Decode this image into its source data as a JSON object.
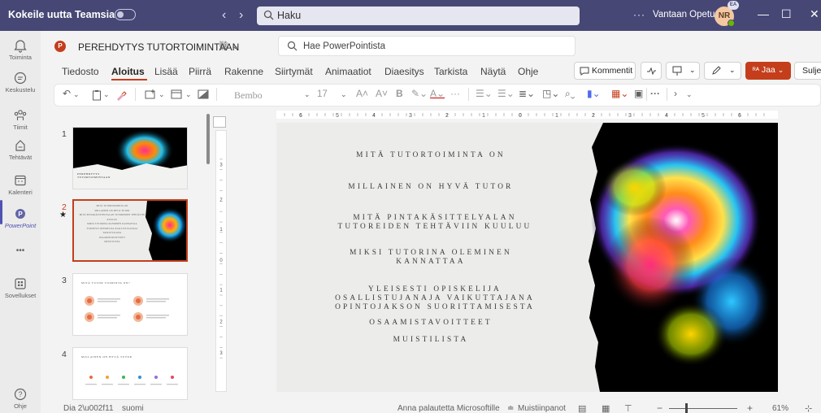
{
  "teams": {
    "title": "Kokeile uutta Teamsia",
    "search_placeholder": "Haku",
    "more": "···",
    "org": "Vantaan Opetus",
    "avatar_initials": "NR",
    "avatar_badge": "EA",
    "window_controls": [
      "—",
      "☐",
      "✕"
    ]
  },
  "rail": {
    "items": [
      {
        "label": "Toiminta",
        "icon": "bell-icon"
      },
      {
        "label": "Keskustelu",
        "icon": "chat-icon"
      },
      {
        "label": "Tiimit",
        "icon": "teams-icon"
      },
      {
        "label": "Tehtävät",
        "icon": "assignments-icon"
      },
      {
        "label": "Kalenteri",
        "icon": "calendar-icon"
      },
      {
        "label": "PowerPoint",
        "icon": "powerpoint-icon"
      },
      {
        "label": "•••",
        "icon": "more-icon"
      },
      {
        "label": "Sovellukset",
        "icon": "apps-icon"
      },
      {
        "label": "Ohje",
        "icon": "help-icon"
      }
    ],
    "active_index": 5
  },
  "ppt": {
    "app_badge": "P",
    "doc_title": "PEREHDYTYS TUTORTOIMINTAAN",
    "doc_title_suffix": "⛓ ⌄",
    "search_placeholder": "Hae PowerPointista",
    "tabs": [
      "Tiedosto",
      "Aloitus",
      "Lisää",
      "Piirrä",
      "Rakenne",
      "Siirtymät",
      "Animaatiot",
      "Diaesitys",
      "Tarkista",
      "Näytä",
      "Ohje"
    ],
    "active_tab": "Aloitus",
    "comments_label": "Kommentit",
    "share_label": "Jaa",
    "close_label": "Sulje",
    "font_name": "Bembo",
    "font_size": "17"
  },
  "thumbnails": [
    {
      "number": "1",
      "lines": [
        "PEREHDYTYS",
        "TUTORTOIMINTAAN"
      ]
    },
    {
      "number": "2",
      "star": "★",
      "lines": [
        "MITÄ TUTORTOIMINTA ON",
        "MILLAINEN ON HYVÄ TUTOR",
        "MITÄ PINTAKÄSITTELYALAN TUTOREIDEN TEHTÄVIIN KUULUU",
        "MIKSI TUTORINA OLEMINEN KANNATTAA",
        "YLEISESTI OPISKELIJA OSALLISTUJANAJA VAIKUTTAJANA",
        "OSAAMISTAVOITTEET",
        "MUISTILISTA"
      ]
    },
    {
      "number": "3",
      "lines": [
        "MITÄ TUTOR TOIMINTA ON?"
      ]
    },
    {
      "number": "4",
      "lines": [
        "MILLAINEN ON HYVÄ TUTOR"
      ]
    }
  ],
  "slide": {
    "items": [
      "MITÄ TUTORTOIMINTA ON",
      "MILLAINEN ON HYVÄ TUTOR",
      "MITÄ PINTAKÄSITTELYALAN\nTUTOREIDEN TEHTÄVIIN KUULUU",
      "MIKSI TUTORINA OLEMINEN\nKANNATTAA",
      "YLEISESTI OPISKELIJA\nOSALLISTUJANAJA VAIKUTTAJANA\nOPINTOJAKSON SUORITTAMISESTA",
      "OSAAMISTAVOITTEET",
      "MUISTILISTA"
    ]
  },
  "status": {
    "slide_info": "Dia 2\\u002f11",
    "language": "suomi",
    "feedback": "Anna palautetta Microsoftille",
    "notes": "Muistiinpanot",
    "zoom": "61%",
    "zoom_fraction": 0.25
  },
  "colors": {
    "teams_purple": "#464775",
    "ppt_accent": "#c43e1c",
    "rail_active": "#4f52b2"
  }
}
